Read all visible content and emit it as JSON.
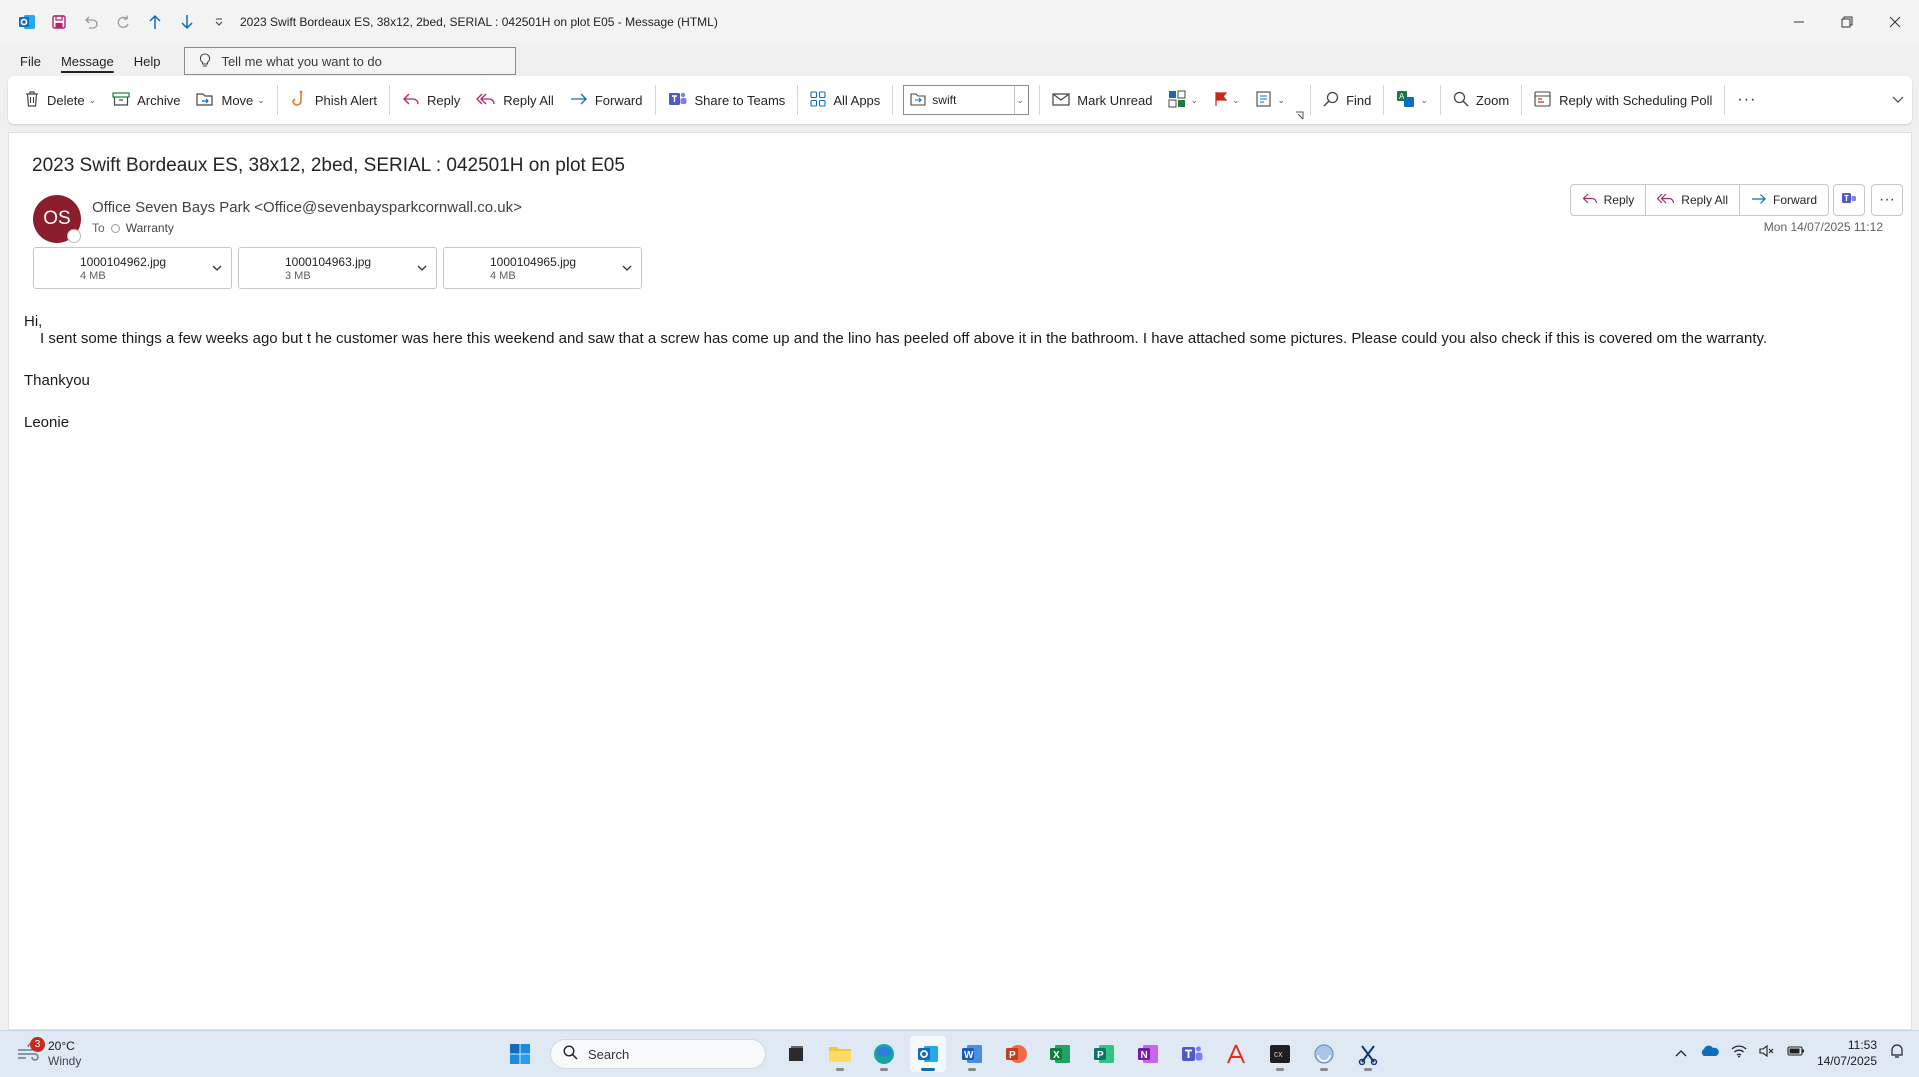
{
  "window": {
    "title": "2023 Swift Bordeaux ES, 38x12, 2bed, SERIAL : 042501H on plot E05  -  Message (HTML)"
  },
  "menu": {
    "tabs": [
      "File",
      "Message",
      "Help"
    ],
    "tell_me": "Tell me what you want to do"
  },
  "ribbon": {
    "delete": "Delete",
    "archive": "Archive",
    "move": "Move",
    "phish_alert": "Phish Alert",
    "reply": "Reply",
    "reply_all": "Reply All",
    "forward": "Forward",
    "share_teams": "Share to Teams",
    "all_apps": "All Apps",
    "quick_step": "swift",
    "mark_unread": "Mark Unread",
    "find": "Find",
    "zoom": "Zoom",
    "scheduling_poll": "Reply with Scheduling Poll"
  },
  "message": {
    "subject": "2023 Swift Bordeaux ES, 38x12, 2bed, SERIAL : 042501H on plot E05",
    "avatar_initials": "OS",
    "avatar_color": "#8b1d2c",
    "sender": "Office Seven Bays Park <Office@sevenbaysparkcornwall.co.uk>",
    "to_label": "To",
    "recipient": "Warranty",
    "date": "Mon 14/07/2025 11:12",
    "actions": {
      "reply": "Reply",
      "reply_all": "Reply All",
      "forward": "Forward"
    },
    "attachments": [
      {
        "name": "1000104962.jpg",
        "size": "4 MB"
      },
      {
        "name": "1000104963.jpg",
        "size": "3 MB"
      },
      {
        "name": "1000104965.jpg",
        "size": "4 MB"
      }
    ],
    "body": {
      "greeting": "Hi,",
      "paragraph": "I sent some things a few weeks ago but t he customer was here this weekend and saw that a screw has come up and the lino has peeled off above it in the bathroom. I have attached some pictures. Please could you also check if this is covered om the warranty.",
      "thanks": "Thankyou",
      "signature": "Leonie"
    }
  },
  "taskbar": {
    "weather_badge": "3",
    "temperature": "20°C",
    "condition": "Windy",
    "search_placeholder": "Search",
    "time": "11:53",
    "date": "14/07/2025"
  },
  "colors": {
    "accent": "#0f6cbd",
    "flag": "#c42b1c"
  }
}
